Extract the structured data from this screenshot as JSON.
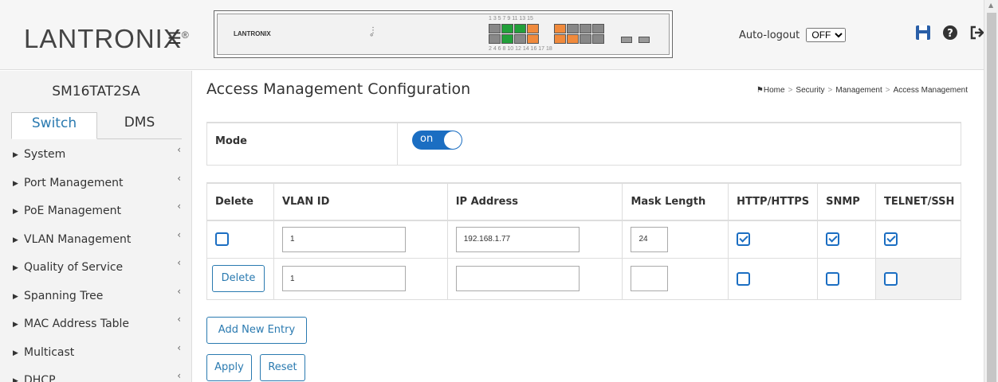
{
  "header": {
    "logo_text": "LANTRONIX",
    "logo_mark": "®",
    "panel_brand": "LANTRONIX",
    "port_numbers_top": "1  3  5  7    9  11 13 15",
    "port_numbers_bottom": "2  4  6  8   10 12 14 16   17   18",
    "autologout_label": "Auto-logout",
    "autologout_value": "OFF"
  },
  "sidebar": {
    "device_name": "SM16TAT2SA",
    "tabs": [
      {
        "label": "Switch",
        "active": true
      },
      {
        "label": "DMS",
        "active": false
      }
    ],
    "items": [
      {
        "label": "System"
      },
      {
        "label": "Port Management"
      },
      {
        "label": "PoE Management"
      },
      {
        "label": "VLAN Management"
      },
      {
        "label": "Quality of Service"
      },
      {
        "label": "Spanning Tree"
      },
      {
        "label": "MAC Address Table"
      },
      {
        "label": "Multicast"
      },
      {
        "label": "DHCP"
      }
    ]
  },
  "main": {
    "title": "Access Management Configuration",
    "breadcrumb": [
      "Home",
      "Security",
      "Management",
      "Access Management"
    ],
    "mode_label": "Mode",
    "mode_toggle": "on",
    "table": {
      "headers": [
        "Delete",
        "VLAN ID",
        "IP Address",
        "Mask Length",
        "HTTP/HTTPS",
        "SNMP",
        "TELNET/SSH"
      ],
      "rows": [
        {
          "vlan_id": "1",
          "ip": "192.168.1.77",
          "mask": "24",
          "http": true,
          "snmp": true,
          "telnet": true
        },
        {
          "delete_label": "Delete",
          "vlan_id": "1",
          "ip": "",
          "mask": "",
          "http": false,
          "snmp": false,
          "telnet": false
        }
      ]
    },
    "add_button": "Add New Entry",
    "apply_button": "Apply",
    "reset_button": "Reset"
  },
  "colors": {
    "accent": "#1b6ec2",
    "link": "#2a7ab0",
    "port_green": "#22a03a",
    "port_orange": "#f08a3c",
    "port_gray": "#888888"
  }
}
